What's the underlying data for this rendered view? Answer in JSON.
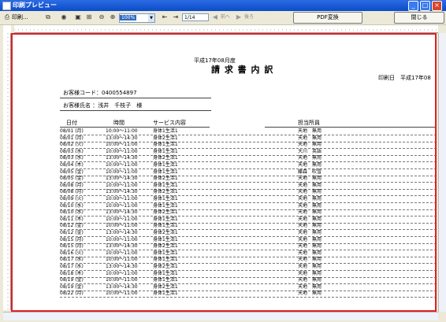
{
  "window": {
    "title": "印刷プレビュー",
    "minimize": "_",
    "maximize": "□",
    "close": "×"
  },
  "toolbar": {
    "print_label": "印刷...",
    "zoom_value": "100%",
    "page_value": "1/14",
    "prev_label": "前へ",
    "next_label": "後ろ",
    "pdf_button": "PDF変換",
    "close_button": "閉じる"
  },
  "document": {
    "era_month": "平成17年08月度",
    "title": "請 求 書 内 訳",
    "print_date_label": "印刷日　平成17年08",
    "customer_code_label": "お客様コード：0400554897",
    "customer_name_label": "お客様氏名 ：浅井　千枝子　様",
    "headers": {
      "date": "日付",
      "time": "時間",
      "service": "サービス内容",
      "staff": "担当所員"
    },
    "rows": [
      {
        "date": "08/01 (月)",
        "time": "10:00〜11:00",
        "service": "身体1生活1",
        "staff": "天地　無用"
      },
      {
        "date": "08/01 (月)",
        "time": "13:00〜14:30",
        "service": "身体2生活1",
        "staff": "天地　無用"
      },
      {
        "date": "08/02 (火)",
        "time": "10:00〜11:00",
        "service": "身体1生活1",
        "staff": "天地　無用"
      },
      {
        "date": "08/03 (水)",
        "time": "10:00〜11:00",
        "service": "身体1生活1",
        "staff": "大川　英語"
      },
      {
        "date": "08/03 (水)",
        "time": "13:00〜14:30",
        "service": "身体2生活1",
        "staff": "天地　無用"
      },
      {
        "date": "08/04 (木)",
        "time": "10:00〜11:00",
        "service": "身体1生活1",
        "staff": "天地　無用"
      },
      {
        "date": "08/05 (金)",
        "time": "10:00〜11:00",
        "service": "身体1生活1",
        "staff": "藤森　吹雪"
      },
      {
        "date": "08/05 (金)",
        "time": "13:00〜14:30",
        "service": "身体2生活1",
        "staff": "天地　無用"
      },
      {
        "date": "08/08 (月)",
        "time": "10:00〜11:00",
        "service": "身体1生活1",
        "staff": "天地　無用"
      },
      {
        "date": "08/08 (月)",
        "time": "13:00〜14:30",
        "service": "身体2生活1",
        "staff": "天地　無用"
      },
      {
        "date": "08/09 (火)",
        "time": "10:00〜11:00",
        "service": "身体1生活1",
        "staff": "天地　無用"
      },
      {
        "date": "08/10 (水)",
        "time": "10:00〜11:00",
        "service": "身体1生活1",
        "staff": "天地　無用"
      },
      {
        "date": "08/10 (水)",
        "time": "13:00〜14:30",
        "service": "身体2生活1",
        "staff": "天地　無用"
      },
      {
        "date": "08/11 (木)",
        "time": "10:00〜11:00",
        "service": "身体1生活1",
        "staff": "天地　無用"
      },
      {
        "date": "08/12 (金)",
        "time": "10:00〜11:00",
        "service": "身体1生活1",
        "staff": "天地　無用"
      },
      {
        "date": "08/12 (金)",
        "time": "13:00〜14:30",
        "service": "身体2生活1",
        "staff": "天地　無用"
      },
      {
        "date": "08/15 (月)",
        "time": "10:00〜11:00",
        "service": "身体1生活1",
        "staff": "天地　無用"
      },
      {
        "date": "08/15 (月)",
        "time": "13:00〜14:30",
        "service": "身体2生活1",
        "staff": "天地　無用"
      },
      {
        "date": "08/16 (火)",
        "time": "10:00〜11:00",
        "service": "身体1生活1",
        "staff": "天地　無用"
      },
      {
        "date": "08/17 (水)",
        "time": "10:00〜11:00",
        "service": "身体1生活1",
        "staff": "天地　無用"
      },
      {
        "date": "08/17 (水)",
        "time": "13:00〜14:30",
        "service": "身体2生活1",
        "staff": "天地　無用"
      },
      {
        "date": "08/18 (木)",
        "time": "10:00〜11:00",
        "service": "身体1生活1",
        "staff": "天地　無用"
      },
      {
        "date": "08/19 (金)",
        "time": "10:00〜11:00",
        "service": "身体1生活1",
        "staff": "天地　無用"
      },
      {
        "date": "08/19 (金)",
        "time": "13:00〜14:30",
        "service": "身体2生活1",
        "staff": "天地　無用"
      },
      {
        "date": "08/22 (月)",
        "time": "10:00〜11:00",
        "service": "身体1生活1",
        "staff": "天地　無用"
      }
    ]
  }
}
